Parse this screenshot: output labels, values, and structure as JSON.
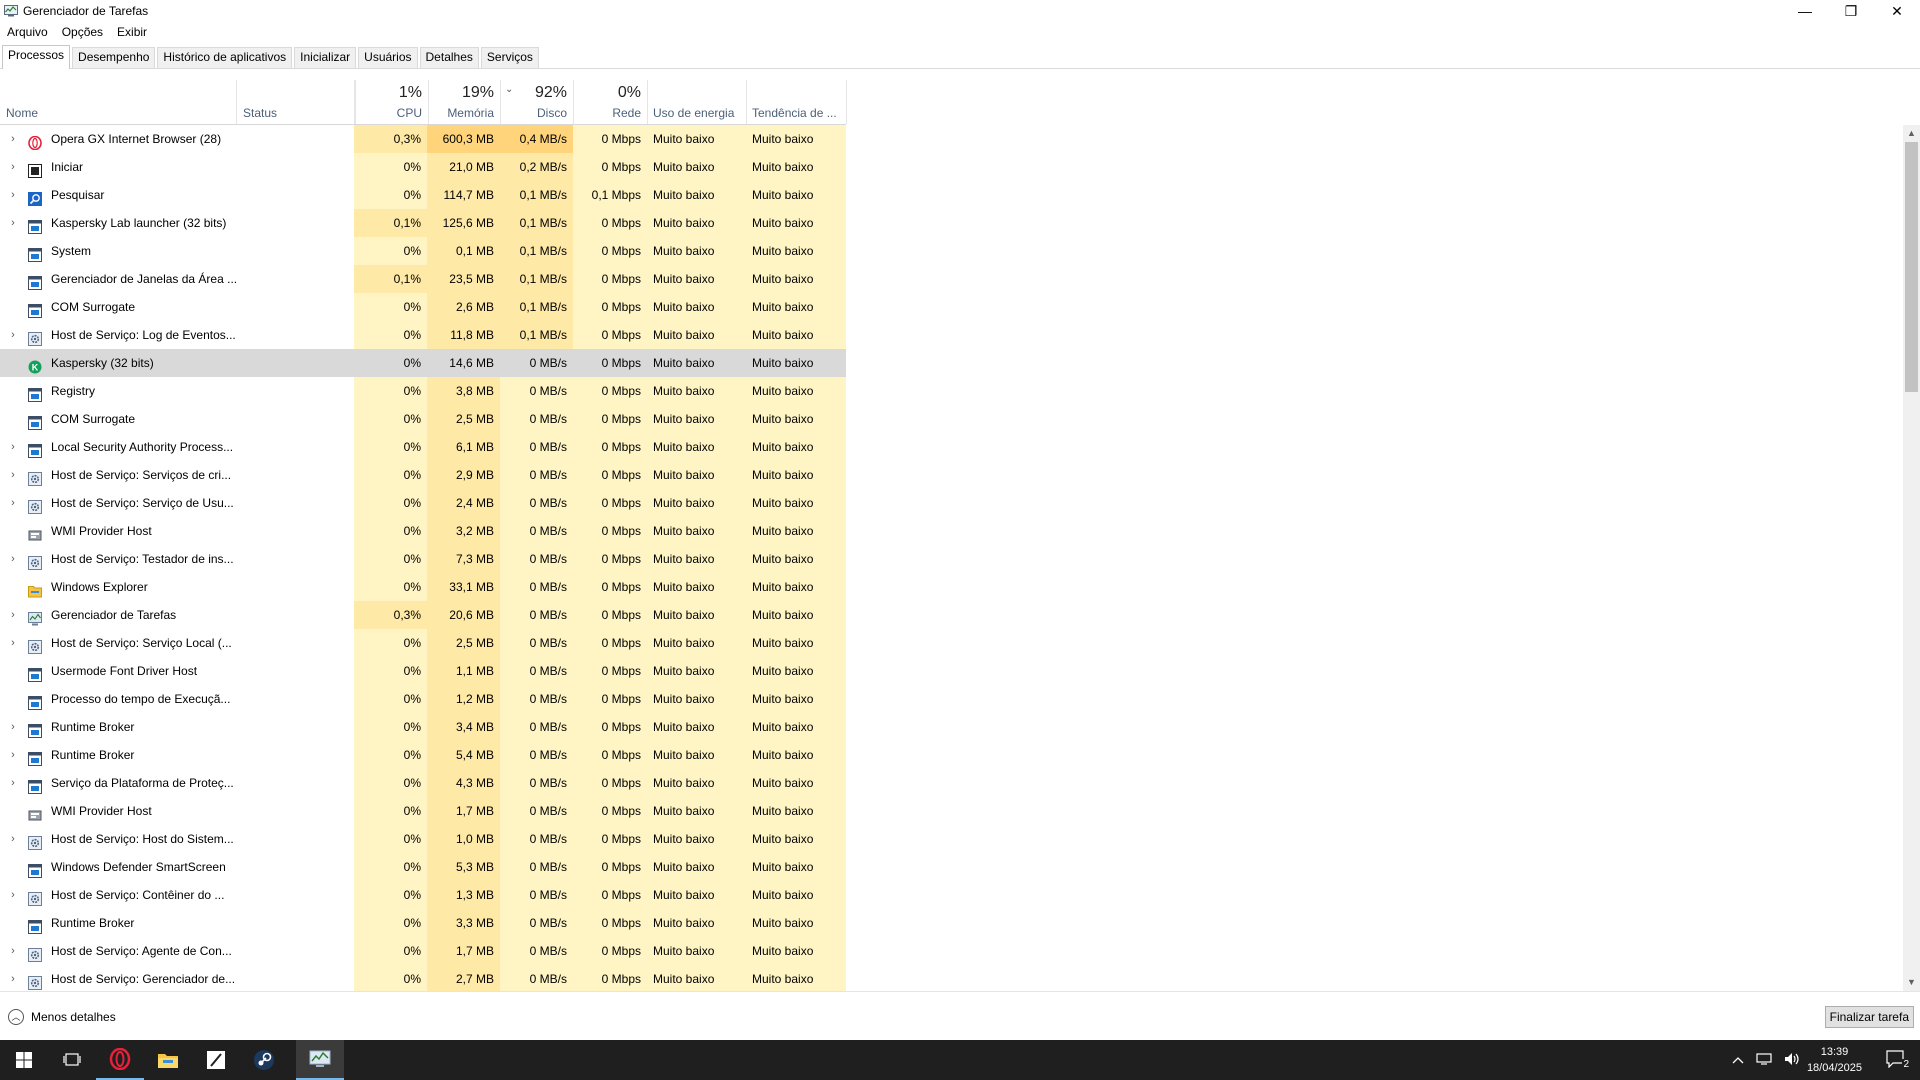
{
  "window": {
    "title": "Gerenciador de Tarefas",
    "controls": {
      "minimize": "—",
      "maximize": "❐",
      "close": "✕"
    }
  },
  "menu": [
    "Arquivo",
    "Opções",
    "Exibir"
  ],
  "tabs": [
    "Processos",
    "Desempenho",
    "Histórico de aplicativos",
    "Inicializar",
    "Usuários",
    "Detalhes",
    "Serviços"
  ],
  "columns": {
    "name": "Nome",
    "status": "Status",
    "cpu": {
      "percent": "1%",
      "label": "CPU"
    },
    "memory": {
      "percent": "19%",
      "label": "Memória"
    },
    "disk": {
      "percent": "92%",
      "label": "Disco"
    },
    "network": {
      "percent": "0%",
      "label": "Rede"
    },
    "power": "Uso de energia",
    "trend": "Tendência de ..."
  },
  "processes": [
    {
      "name": "Opera GX Internet Browser (28)",
      "expand": true,
      "icon": "opera-icon",
      "cpu": "0,3%",
      "mem": "600,3 MB",
      "disk": "0,4 MB/s",
      "net": "0 Mbps",
      "power": "Muito baixo",
      "trend": "Muito baixo"
    },
    {
      "name": "Iniciar",
      "expand": true,
      "icon": "start-icon",
      "cpu": "0%",
      "mem": "21,0 MB",
      "disk": "0,2 MB/s",
      "net": "0 Mbps",
      "power": "Muito baixo",
      "trend": "Muito baixo"
    },
    {
      "name": "Pesquisar",
      "expand": true,
      "icon": "search-icon",
      "cpu": "0%",
      "mem": "114,7 MB",
      "disk": "0,1 MB/s",
      "net": "0,1 Mbps",
      "power": "Muito baixo",
      "trend": "Muito baixo"
    },
    {
      "name": "Kaspersky Lab launcher (32 bits)",
      "expand": true,
      "icon": "window-icon",
      "cpu": "0,1%",
      "mem": "125,6 MB",
      "disk": "0,1 MB/s",
      "net": "0 Mbps",
      "power": "Muito baixo",
      "trend": "Muito baixo"
    },
    {
      "name": "System",
      "expand": false,
      "icon": "window-icon",
      "cpu": "0%",
      "mem": "0,1 MB",
      "disk": "0,1 MB/s",
      "net": "0 Mbps",
      "power": "Muito baixo",
      "trend": "Muito baixo"
    },
    {
      "name": "Gerenciador de Janelas da Área ...",
      "expand": false,
      "icon": "window-icon",
      "cpu": "0,1%",
      "mem": "23,5 MB",
      "disk": "0,1 MB/s",
      "net": "0 Mbps",
      "power": "Muito baixo",
      "trend": "Muito baixo"
    },
    {
      "name": "COM Surrogate",
      "expand": false,
      "icon": "window-icon",
      "cpu": "0%",
      "mem": "2,6 MB",
      "disk": "0,1 MB/s",
      "net": "0 Mbps",
      "power": "Muito baixo",
      "trend": "Muito baixo"
    },
    {
      "name": "Host de Serviço: Log de Eventos...",
      "expand": true,
      "icon": "gear-icon",
      "cpu": "0%",
      "mem": "11,8 MB",
      "disk": "0,1 MB/s",
      "net": "0 Mbps",
      "power": "Muito baixo",
      "trend": "Muito baixo"
    },
    {
      "name": "Kaspersky (32 bits)",
      "expand": false,
      "icon": "kaspersky-icon",
      "cpu": "0%",
      "mem": "14,6 MB",
      "disk": "0 MB/s",
      "net": "0 Mbps",
      "power": "Muito baixo",
      "trend": "Muito baixo",
      "selected": true
    },
    {
      "name": "Registry",
      "expand": false,
      "icon": "window-icon",
      "cpu": "0%",
      "mem": "3,8 MB",
      "disk": "0 MB/s",
      "net": "0 Mbps",
      "power": "Muito baixo",
      "trend": "Muito baixo"
    },
    {
      "name": "COM Surrogate",
      "expand": false,
      "icon": "window-icon",
      "cpu": "0%",
      "mem": "2,5 MB",
      "disk": "0 MB/s",
      "net": "0 Mbps",
      "power": "Muito baixo",
      "trend": "Muito baixo"
    },
    {
      "name": "Local Security Authority Process...",
      "expand": true,
      "icon": "window-icon",
      "cpu": "0%",
      "mem": "6,1 MB",
      "disk": "0 MB/s",
      "net": "0 Mbps",
      "power": "Muito baixo",
      "trend": "Muito baixo"
    },
    {
      "name": "Host de Serviço: Serviços de cri...",
      "expand": true,
      "icon": "gear-icon",
      "cpu": "0%",
      "mem": "2,9 MB",
      "disk": "0 MB/s",
      "net": "0 Mbps",
      "power": "Muito baixo",
      "trend": "Muito baixo"
    },
    {
      "name": "Host de Serviço: Serviço de Usu...",
      "expand": true,
      "icon": "gear-icon",
      "cpu": "0%",
      "mem": "2,4 MB",
      "disk": "0 MB/s",
      "net": "0 Mbps",
      "power": "Muito baixo",
      "trend": "Muito baixo"
    },
    {
      "name": "WMI Provider Host",
      "expand": false,
      "icon": "wmi-icon",
      "cpu": "0%",
      "mem": "3,2 MB",
      "disk": "0 MB/s",
      "net": "0 Mbps",
      "power": "Muito baixo",
      "trend": "Muito baixo"
    },
    {
      "name": "Host de Serviço: Testador de ins...",
      "expand": true,
      "icon": "gear-icon",
      "cpu": "0%",
      "mem": "7,3 MB",
      "disk": "0 MB/s",
      "net": "0 Mbps",
      "power": "Muito baixo",
      "trend": "Muito baixo"
    },
    {
      "name": "Windows Explorer",
      "expand": false,
      "icon": "folder-icon",
      "cpu": "0%",
      "mem": "33,1 MB",
      "disk": "0 MB/s",
      "net": "0 Mbps",
      "power": "Muito baixo",
      "trend": "Muito baixo"
    },
    {
      "name": "Gerenciador de Tarefas",
      "expand": true,
      "icon": "taskmgr-icon",
      "cpu": "0,3%",
      "mem": "20,6 MB",
      "disk": "0 MB/s",
      "net": "0 Mbps",
      "power": "Muito baixo",
      "trend": "Muito baixo"
    },
    {
      "name": "Host de Serviço: Serviço Local (...",
      "expand": true,
      "icon": "gear-icon",
      "cpu": "0%",
      "mem": "2,5 MB",
      "disk": "0 MB/s",
      "net": "0 Mbps",
      "power": "Muito baixo",
      "trend": "Muito baixo"
    },
    {
      "name": "Usermode Font Driver Host",
      "expand": false,
      "icon": "window-icon",
      "cpu": "0%",
      "mem": "1,1 MB",
      "disk": "0 MB/s",
      "net": "0 Mbps",
      "power": "Muito baixo",
      "trend": "Muito baixo"
    },
    {
      "name": "Processo do tempo de Execuçã...",
      "expand": false,
      "icon": "window-icon",
      "cpu": "0%",
      "mem": "1,2 MB",
      "disk": "0 MB/s",
      "net": "0 Mbps",
      "power": "Muito baixo",
      "trend": "Muito baixo"
    },
    {
      "name": "Runtime Broker",
      "expand": true,
      "icon": "window-icon",
      "cpu": "0%",
      "mem": "3,4 MB",
      "disk": "0 MB/s",
      "net": "0 Mbps",
      "power": "Muito baixo",
      "trend": "Muito baixo"
    },
    {
      "name": "Runtime Broker",
      "expand": true,
      "icon": "window-icon",
      "cpu": "0%",
      "mem": "5,4 MB",
      "disk": "0 MB/s",
      "net": "0 Mbps",
      "power": "Muito baixo",
      "trend": "Muito baixo"
    },
    {
      "name": "Serviço da Plataforma de Proteç...",
      "expand": true,
      "icon": "window-icon",
      "cpu": "0%",
      "mem": "4,3 MB",
      "disk": "0 MB/s",
      "net": "0 Mbps",
      "power": "Muito baixo",
      "trend": "Muito baixo"
    },
    {
      "name": "WMI Provider Host",
      "expand": false,
      "icon": "wmi-icon",
      "cpu": "0%",
      "mem": "1,7 MB",
      "disk": "0 MB/s",
      "net": "0 Mbps",
      "power": "Muito baixo",
      "trend": "Muito baixo"
    },
    {
      "name": "Host de Serviço: Host do Sistem...",
      "expand": true,
      "icon": "gear-icon",
      "cpu": "0%",
      "mem": "1,0 MB",
      "disk": "0 MB/s",
      "net": "0 Mbps",
      "power": "Muito baixo",
      "trend": "Muito baixo"
    },
    {
      "name": "Windows Defender SmartScreen",
      "expand": false,
      "icon": "window-icon",
      "cpu": "0%",
      "mem": "5,3 MB",
      "disk": "0 MB/s",
      "net": "0 Mbps",
      "power": "Muito baixo",
      "trend": "Muito baixo"
    },
    {
      "name": "Host de Serviço: Contêiner do ...",
      "expand": true,
      "icon": "gear-icon",
      "cpu": "0%",
      "mem": "1,3 MB",
      "disk": "0 MB/s",
      "net": "0 Mbps",
      "power": "Muito baixo",
      "trend": "Muito baixo"
    },
    {
      "name": "Runtime Broker",
      "expand": false,
      "icon": "window-icon",
      "cpu": "0%",
      "mem": "3,3 MB",
      "disk": "0 MB/s",
      "net": "0 Mbps",
      "power": "Muito baixo",
      "trend": "Muito baixo"
    },
    {
      "name": "Host de Serviço: Agente de Con...",
      "expand": true,
      "icon": "gear-icon",
      "cpu": "0%",
      "mem": "1,7 MB",
      "disk": "0 MB/s",
      "net": "0 Mbps",
      "power": "Muito baixo",
      "trend": "Muito baixo"
    },
    {
      "name": "Host de Serviço: Gerenciador de...",
      "expand": true,
      "icon": "gear-icon",
      "cpu": "0%",
      "mem": "2,7 MB",
      "disk": "0 MB/s",
      "net": "0 Mbps",
      "power": "Muito baixo",
      "trend": "Muito baixo"
    }
  ],
  "footer": {
    "less_details": "Menos detalhes",
    "end_task": "Finalizar tarefa"
  },
  "taskbar": {
    "apps": [
      "windows-start-icon",
      "task-view-icon",
      "opera-gx-icon",
      "file-explorer-icon",
      "note-app-icon",
      "steam-icon",
      "task-manager-icon"
    ],
    "active_app": "task-manager-icon",
    "time": "13:39",
    "date": "18/04/2025",
    "notifications": "2"
  },
  "colors": {
    "heat_low": "#fff4c4",
    "heat_mid": "#ffe9a6",
    "heat_high": "#ffd47a",
    "selected_row": "#d9d9d9",
    "header_label": "#4c607a",
    "taskbar_bg": "#1f1f1f"
  }
}
